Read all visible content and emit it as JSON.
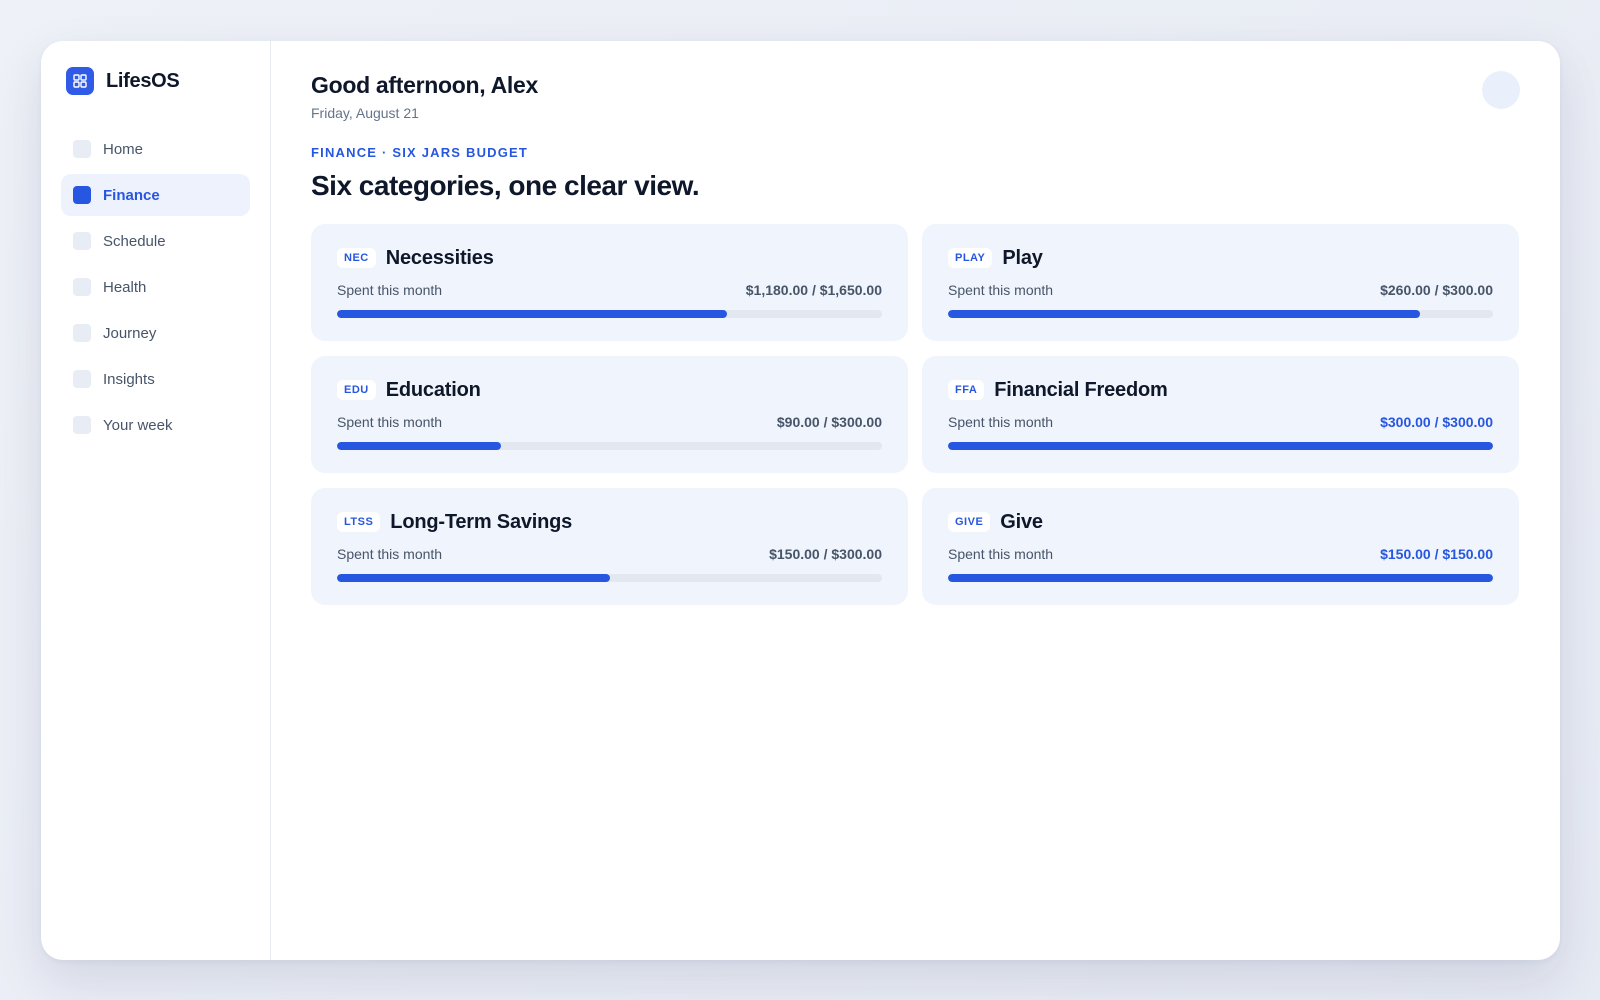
{
  "brand": {
    "name": "LifesOS",
    "logo_icon": "grid-icon",
    "accent": "#2f5be6"
  },
  "sidebar": {
    "items": [
      {
        "label": "Home",
        "active": false
      },
      {
        "label": "Finance",
        "active": true
      },
      {
        "label": "Schedule",
        "active": false
      },
      {
        "label": "Health",
        "active": false
      },
      {
        "label": "Journey",
        "active": false
      },
      {
        "label": "Insights",
        "active": false
      },
      {
        "label": "Your week",
        "active": false
      }
    ]
  },
  "header": {
    "greeting": "Good afternoon, Alex",
    "date": "Friday, August 21"
  },
  "section": {
    "eyebrow": "FINANCE · SIX JARS BUDGET",
    "title": "Six categories, one clear view."
  },
  "jars": [
    {
      "tag": "NEC",
      "name": "Necessities",
      "label": "Spent this month",
      "amount": "$1,180.00 / $1,650.00",
      "spent": 1180,
      "budget": 1650
    },
    {
      "tag": "PLAY",
      "name": "Play",
      "label": "Spent this month",
      "amount": "$260.00 / $300.00",
      "spent": 260,
      "budget": 300
    },
    {
      "tag": "EDU",
      "name": "Education",
      "label": "Spent this month",
      "amount": "$90.00 / $300.00",
      "spent": 90,
      "budget": 300
    },
    {
      "tag": "FFA",
      "name": "Financial Freedom",
      "label": "Spent this month",
      "amount": "$300.00 / $300.00",
      "spent": 300,
      "budget": 300
    },
    {
      "tag": "LTSS",
      "name": "Long-Term Savings",
      "label": "Spent this month",
      "amount": "$150.00 / $300.00",
      "spent": 150,
      "budget": 300
    },
    {
      "tag": "GIVE",
      "name": "Give",
      "label": "Spent this month",
      "amount": "$150.00 / $150.00",
      "spent": 150,
      "budget": 150
    }
  ],
  "colors": {
    "accent": "#2756e0",
    "card_bg": "#f0f4fc",
    "track": "#e2e7f0"
  }
}
